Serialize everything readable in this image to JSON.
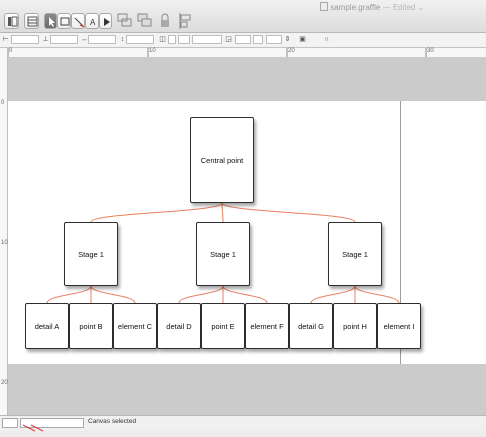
{
  "window": {
    "file_name": "sample.graffle",
    "separator": "—",
    "state": "Edited",
    "chevron": "⌄"
  },
  "toolbar": {
    "tools": [
      "canvas-list-icon",
      "layers-list-icon",
      "selection-tool-icon",
      "shape-tool-icon",
      "line-tool-icon",
      "text-tool-icon",
      "browse-tool-icon",
      "group-icon",
      "ungroup-icon",
      "lock-icon",
      "align-icon"
    ]
  },
  "ruler": {
    "h_labels": [
      "0",
      "10",
      "20",
      "30"
    ],
    "v_labels": [
      "0",
      "10",
      "20"
    ]
  },
  "diagram": {
    "root": {
      "label": "Central point"
    },
    "stages": [
      {
        "label": "Stage 1"
      },
      {
        "label": "Stage 1"
      },
      {
        "label": "Stage 1"
      }
    ],
    "leaves": [
      {
        "label": "detail A"
      },
      {
        "label": "point B"
      },
      {
        "label": "element C"
      },
      {
        "label": "detail D"
      },
      {
        "label": "point E"
      },
      {
        "label": "element F"
      },
      {
        "label": "detail G"
      },
      {
        "label": "point H"
      },
      {
        "label": "element I"
      }
    ],
    "line_color": "#e8805f"
  },
  "status": {
    "text": "Canvas selected"
  }
}
